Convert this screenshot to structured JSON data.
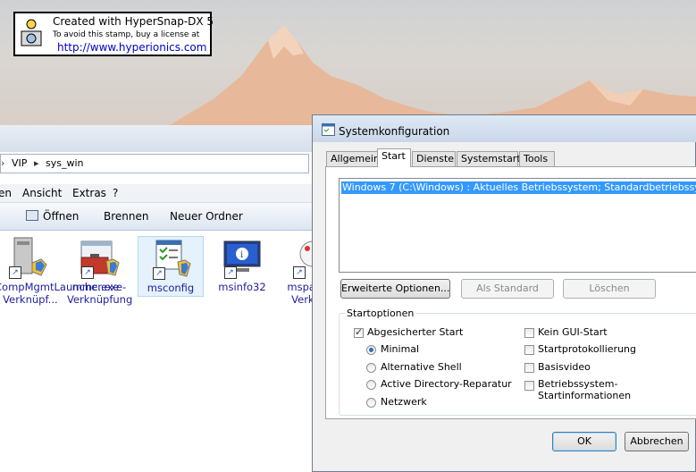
{
  "watermark": {
    "line1": "Created with HyperSnap-DX 5",
    "line2": "To avoid this stamp, buy a license at",
    "line3": "http://www.hyperionics.com"
  },
  "explorer": {
    "breadcrumb": [
      "VIP",
      "sys_win"
    ],
    "menu": [
      "en",
      "Ansicht",
      "Extras",
      "?"
    ],
    "toolbar": {
      "open": "Öffnen",
      "burn": "Brennen",
      "new_folder": "Neuer Ordner"
    },
    "files": [
      {
        "label": "CompMgmtLauncher.exe - Verknüpf...",
        "icon": "computer-management-icon"
      },
      {
        "label": "mmc.exe - Verknüpfung",
        "icon": "toolbox-shield-icon"
      },
      {
        "label": "msconfig",
        "icon": "msconfig-icon",
        "selected": true
      },
      {
        "label": "msinfo32",
        "icon": "system-info-icon"
      },
      {
        "label": "mspa... e Verkn...",
        "icon": "paint-icon"
      }
    ]
  },
  "dialog": {
    "title": "Systemkonfiguration",
    "tabs": [
      "Allgemein",
      "Start",
      "Dienste",
      "Systemstart",
      "Tools"
    ],
    "active_tab": "Start",
    "os_entries": [
      "Windows 7 (C:\\Windows) : Aktuelles Betriebssystem; Standardbetriebssystem"
    ],
    "buttons": {
      "advanced": "Erweiterte Optionen...",
      "default": "Als Standard",
      "delete": "Löschen",
      "ok": "OK",
      "cancel": "Abbrechen"
    },
    "boot_options": {
      "title": "Startoptionen",
      "safe_boot": {
        "label": "Abgesicherter Start",
        "checked": true
      },
      "radios": [
        {
          "label": "Minimal",
          "checked": true
        },
        {
          "label": "Alternative Shell",
          "checked": false
        },
        {
          "label": "Active Directory-Reparatur",
          "checked": false
        },
        {
          "label": "Netzwerk",
          "checked": false
        }
      ],
      "right": {
        "no_gui": "Kein GUI-Start",
        "boot_log": "Startprotokollierung",
        "base_video": "Basisvideo",
        "os_info_1": "Betriebssystem-",
        "os_info_2": "Startinformationen"
      }
    }
  }
}
